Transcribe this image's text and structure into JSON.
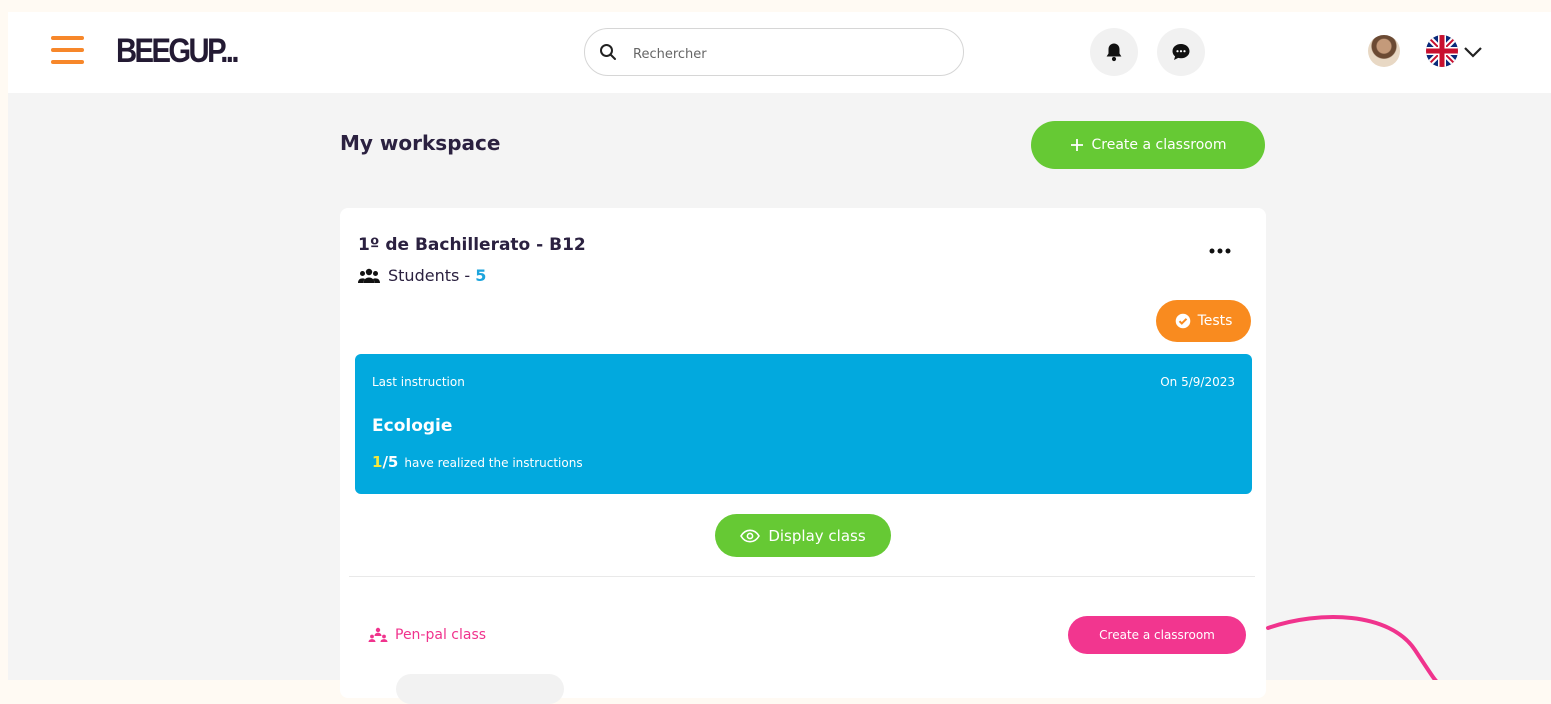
{
  "header": {
    "logo_text": "BEEGUP...",
    "search_placeholder": "Rechercher",
    "icons": [
      "menu-icon",
      "search-icon",
      "bell-icon",
      "chat-icon",
      "avatar",
      "uk-flag-icon",
      "chevron-down-icon"
    ]
  },
  "workspace": {
    "title": "My workspace",
    "create_classroom_label": "Create a classroom"
  },
  "classroom": {
    "name": "1º de Bachillerato - B12",
    "students_label": "Students - ",
    "students_count": "5",
    "tests_label": "Tests",
    "last_instruction": {
      "label": "Last instruction",
      "date": "On 5/9/2023",
      "title": "Ecologie",
      "done": "1",
      "total": "/5",
      "progress_text": "have realized the instructions"
    },
    "display_label": "Display class",
    "penpal_label": "Pen-pal class",
    "penpal_create_label": "Create a classroom"
  },
  "colors": {
    "accent_orange": "#f7872a",
    "green": "#66c934",
    "blue": "#02a9de",
    "pink": "#f2368f",
    "text_dark": "#2b2140"
  }
}
